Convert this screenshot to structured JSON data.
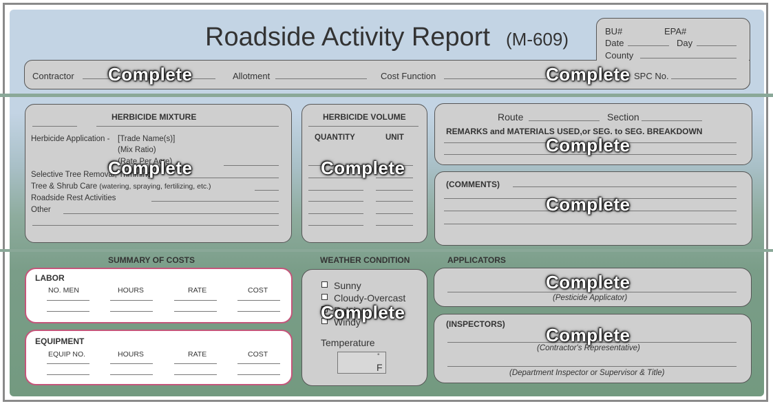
{
  "header": {
    "title": "Roadside Activity Report",
    "form_code": "(M-609)",
    "bu_label": "BU#",
    "epa_label": "EPA#",
    "date_label": "Date",
    "day_label": "Day",
    "county_label": "County",
    "contractor_label": "Contractor",
    "allotment_label": "Allotment",
    "cost_function_label": "Cost Function",
    "spc_label": "SPC No."
  },
  "herbicide_mixture": {
    "heading": "HERBICIDE MIXTURE",
    "application_label": "Herbicide Application -",
    "trade_names": "[Trade Name(s)]",
    "mix_ratio": "(Mix Ratio)",
    "rate_per_acre": "(Rate Per Acre)",
    "selective_tree": "Selective Tree Removal, Trimming",
    "tree_shrub": "Tree & Shrub Care",
    "tree_shrub_note": "(watering, spraying, fertilizing, etc.)",
    "roadside_rest": "Roadside Rest Activities",
    "other": "Other"
  },
  "herbicide_volume": {
    "heading": "HERBICIDE VOLUME",
    "quantity_label": "QUANTITY",
    "unit_label": "UNIT"
  },
  "route": {
    "route_label": "Route",
    "section_label": "Section",
    "remarks_label": "REMARKS and MATERIALS USED,or SEG. to SEG. BREAKDOWN"
  },
  "comments": {
    "label": "(COMMENTS)"
  },
  "summary_costs": {
    "heading": "SUMMARY OF COSTS",
    "labor": {
      "title": "LABOR",
      "columns": [
        "NO. MEN",
        "HOURS",
        "RATE",
        "COST"
      ]
    },
    "equipment": {
      "title": "EQUIPMENT",
      "columns": [
        "EQUIP NO.",
        "HOURS",
        "RATE",
        "COST"
      ]
    }
  },
  "weather": {
    "heading": "WEATHER CONDITION",
    "options": [
      "Sunny",
      "Cloudy-Overcast",
      "Raining",
      "Windy"
    ],
    "temperature_label": "Temperature",
    "degree_symbol": "°",
    "unit": "F"
  },
  "applicators": {
    "heading": "APPLICATORS",
    "pesticide_caption": "(Pesticide Applicator)"
  },
  "inspectors": {
    "label": "(INSPECTORS)",
    "contractor_caption": "(Contractor's Representative)",
    "department_caption": "(Department Inspector or Supervisor & Title)"
  },
  "stamps": {
    "contractor": "Complete",
    "cost_function": "Complete",
    "herbicide_mixture": "Complete",
    "herbicide_volume": "Complete",
    "remarks": "Complete",
    "comments": "Complete",
    "weather": "Complete",
    "applicators": "Complete",
    "inspectors": "Complete"
  },
  "colors": {
    "panel": "#cfcfcf",
    "header_band": "#c3d4e4",
    "lower_band": "#739a80",
    "box_border": "#c4557a",
    "stamp_text": "#ffffff"
  }
}
